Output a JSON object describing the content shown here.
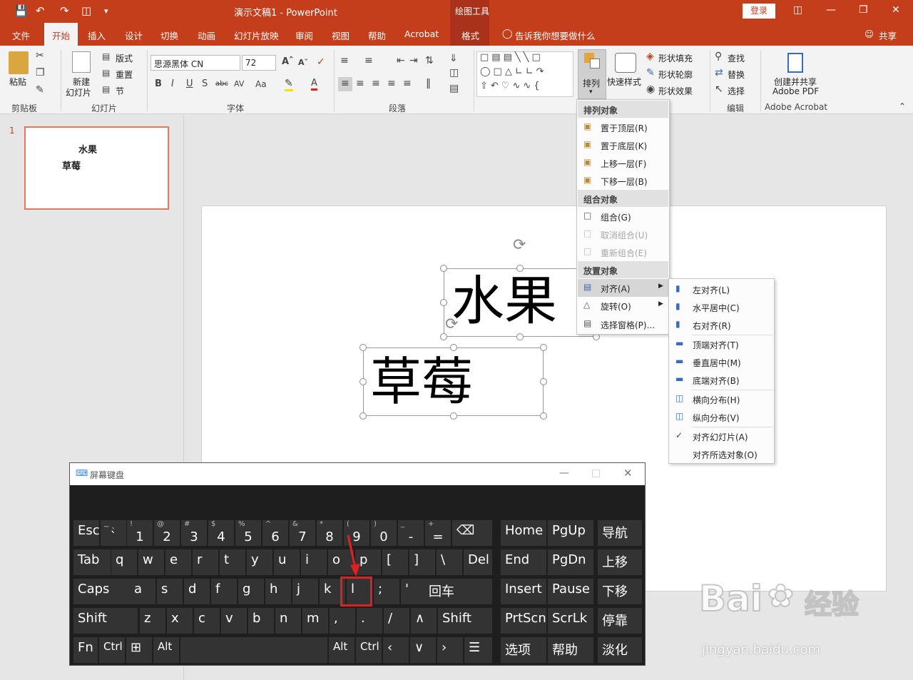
{
  "window": {
    "title": "演示文稿1  -  PowerPoint",
    "context_group": "绘图工具",
    "login": "登录",
    "share": "共享",
    "tell_me": "告诉我你想要做什么"
  },
  "tabs": [
    "文件",
    "开始",
    "插入",
    "设计",
    "切换",
    "动画",
    "幻灯片放映",
    "审阅",
    "视图",
    "帮助",
    "Acrobat",
    "格式"
  ],
  "ribbon": {
    "clipboard": {
      "label": "剪贴板",
      "paste": "粘贴"
    },
    "slides": {
      "label": "幻灯片",
      "new_slide_1": "新建",
      "new_slide_2": "幻灯片",
      "layout": "版式",
      "reset": "重置",
      "section": "节"
    },
    "font": {
      "label": "字体",
      "font_name": "思源黑体 CN",
      "font_size": "72"
    },
    "paragraph": {
      "label": "段落"
    },
    "drawing": {
      "arrange": "排列",
      "quick_styles": "快速样式",
      "fill": "形状填充",
      "outline": "形状轮廓",
      "effects": "形状效果"
    },
    "editing": {
      "label": "编辑",
      "find": "查找",
      "replace": "替换",
      "select": "选择"
    },
    "acrobat": {
      "label": "Adobe Acrobat",
      "create_1": "创建并共享",
      "create_2": "Adobe PDF"
    }
  },
  "thumbnail": {
    "number": "1",
    "line1": "水果",
    "line2": "草莓"
  },
  "slide": {
    "text1": "水果",
    "text2": "草莓"
  },
  "arrange_menu": {
    "order_header": "排列对象",
    "order_items": [
      "置于顶层(R)",
      "置于底层(K)",
      "上移一层(F)",
      "下移一层(B)"
    ],
    "group_header": "组合对象",
    "group_items": [
      "组合(G)",
      "取消组合(U)",
      "重新组合(E)"
    ],
    "position_header": "放置对象",
    "position_items": [
      "对齐(A)",
      "旋转(O)",
      "选择窗格(P)..."
    ]
  },
  "align_menu": {
    "items": [
      "左对齐(L)",
      "水平居中(C)",
      "右对齐(R)",
      "顶端对齐(T)",
      "垂直居中(M)",
      "底端对齐(B)",
      "横向分布(H)",
      "纵向分布(V)",
      "对齐幻灯片(A)",
      "对齐所选对象(O)"
    ],
    "checked": "对齐幻灯片(A)"
  },
  "osk": {
    "title": "屏幕键盘",
    "row1": [
      [
        "Esc",
        ""
      ],
      [
        "`",
        "~ 、"
      ],
      [
        "1",
        "!"
      ],
      [
        "2",
        "@"
      ],
      [
        "3",
        "#"
      ],
      [
        "4",
        "$"
      ],
      [
        "5",
        "%"
      ],
      [
        "6",
        "^"
      ],
      [
        "7",
        "&"
      ],
      [
        "8",
        "*"
      ],
      [
        "9",
        "("
      ],
      [
        "0",
        ")"
      ],
      [
        "-",
        "_"
      ],
      [
        "=",
        "+"
      ]
    ],
    "row2": [
      "Tab",
      "q",
      "w",
      "e",
      "r",
      "t",
      "y",
      "u",
      "i",
      "o",
      "p",
      "[",
      "]",
      "\\",
      "Del"
    ],
    "row3": [
      "Caps",
      "a",
      "s",
      "d",
      "f",
      "g",
      "h",
      "j",
      "k",
      "l",
      ";",
      "'",
      "回车"
    ],
    "row4": [
      "Shift",
      "z",
      "x",
      "c",
      "v",
      "b",
      "n",
      "m",
      ",",
      ".",
      "/",
      "Shift"
    ],
    "row5": [
      "Fn",
      "Ctrl",
      "Alt",
      "Alt",
      "Ctrl"
    ],
    "nav": [
      "Home",
      "PgUp",
      "导航",
      "End",
      "PgDn",
      "上移",
      "Insert",
      "Pause",
      "下移",
      "PrtScn",
      "ScrLk",
      "停靠",
      "选项",
      "帮助",
      "淡化"
    ]
  },
  "watermark": {
    "brand": "Bai",
    "brand2": "经验",
    "url": "jingyan.baidu.com"
  },
  "colors": {
    "accent": "#c43e1c",
    "highlight": "#e02020"
  }
}
